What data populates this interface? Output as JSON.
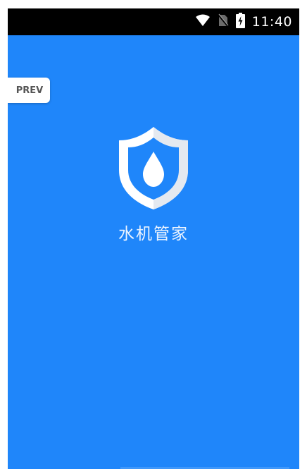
{
  "status_bar": {
    "time": "11:40",
    "icons": [
      "wifi-icon",
      "no-sim-icon",
      "battery-charging-icon"
    ]
  },
  "prev_button": {
    "label": "PREV"
  },
  "splash": {
    "logo_icon": "shield-water-drop-icon",
    "app_name": "水机管家"
  },
  "colors": {
    "background": "#1f86fa",
    "status_bar": "#000000",
    "shield": "#ffffff",
    "drop": "#1f86fa"
  }
}
